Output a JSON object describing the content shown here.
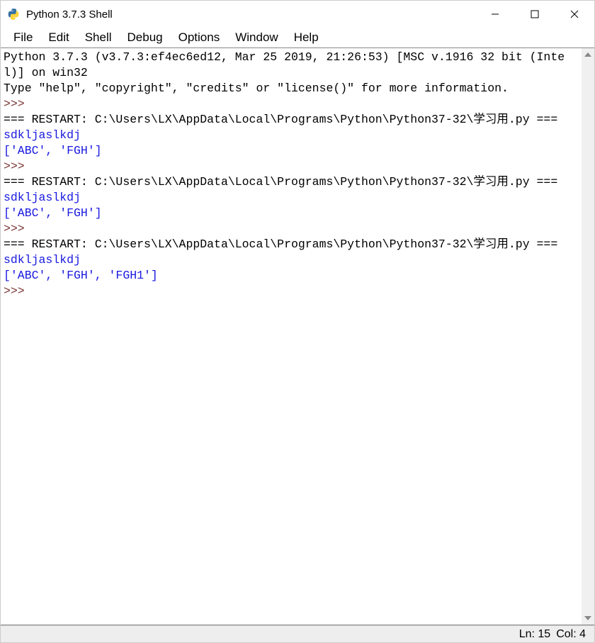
{
  "window": {
    "title": "Python 3.7.3 Shell"
  },
  "menu": {
    "items": [
      "File",
      "Edit",
      "Shell",
      "Debug",
      "Options",
      "Window",
      "Help"
    ]
  },
  "console": {
    "header_line1": "Python 3.7.3 (v3.7.3:ef4ec6ed12, Mar 25 2019, 21:26:53) [MSC v.1916 32 bit (Intel)] on win32",
    "header_line2": "Type \"help\", \"copyright\", \"credits\" or \"license()\" for more information.",
    "prompt": ">>> ",
    "runs": [
      {
        "restart": "=== RESTART: C:\\Users\\LX\\AppData\\Local\\Programs\\Python\\Python37-32\\学习用.py ===",
        "input": "sdkljaslkdj",
        "output": "['ABC', 'FGH']"
      },
      {
        "restart": "=== RESTART: C:\\Users\\LX\\AppData\\Local\\Programs\\Python\\Python37-32\\学习用.py ===",
        "input": "sdkljaslkdj",
        "output": "['ABC', 'FGH']"
      },
      {
        "restart": "=== RESTART: C:\\Users\\LX\\AppData\\Local\\Programs\\Python\\Python37-32\\学习用.py ===",
        "input": "sdkljaslkdj",
        "output": "['ABC', 'FGH', 'FGH1']"
      }
    ]
  },
  "status": {
    "line": "Ln: 15",
    "col": "Col: 4"
  }
}
